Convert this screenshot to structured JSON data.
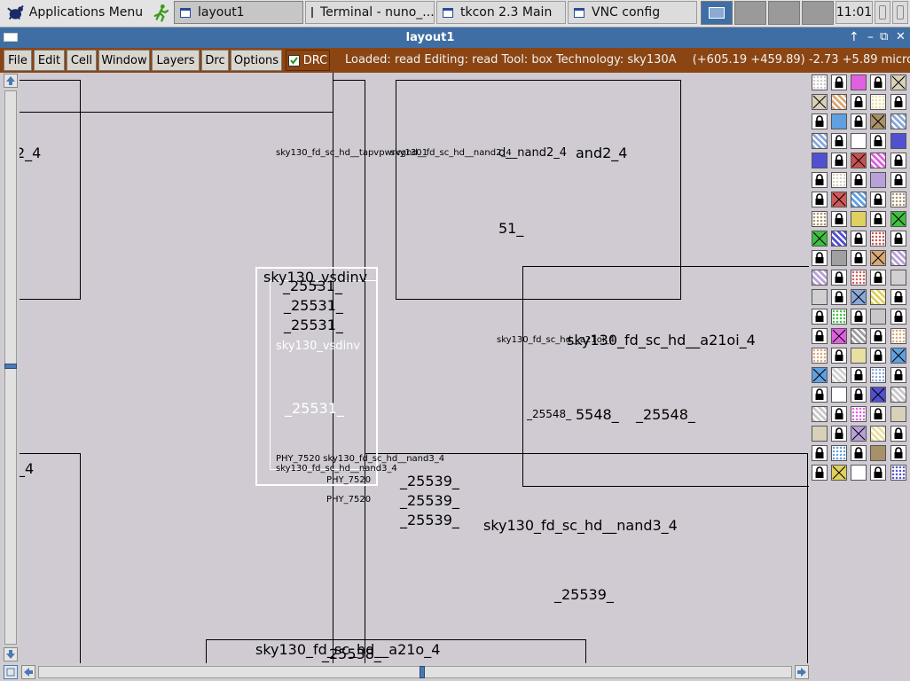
{
  "taskbar": {
    "apps_menu": "Applications Menu",
    "windows": [
      {
        "label": "layout1",
        "icon": "window-icon"
      },
      {
        "label": "Terminal - nuno_...",
        "icon": "terminal-icon"
      },
      {
        "label": "tkcon 2.3 Main",
        "icon": "window-icon"
      },
      {
        "label": "VNC config",
        "icon": "window-icon"
      }
    ],
    "clock": "11:01"
  },
  "window": {
    "title": "layout1",
    "controls": [
      "↑",
      "–",
      "⧉",
      "✕"
    ]
  },
  "menu": {
    "items": [
      "File",
      "Edit",
      "Cell",
      "Window",
      "Layers",
      "Drc",
      "Options"
    ],
    "drc_label": "DRC",
    "drc_checked": true
  },
  "status": {
    "text": "Loaded: read Editing: read Tool: box  Technology: sky130A",
    "coords": "(+605.19 +459.89) -2.73 +5.89 microns"
  },
  "canvas_labels": {
    "l_2_4": "2_4",
    "l_4": "_4",
    "tap_small": "sky130_fd_sc_hd__tapvpwrvgnd_1",
    "nand2_small": "sky130_fd_sc_hd__nand2_4",
    "nand2_mid": "d__nand2_4",
    "nand2_big": "and2_4",
    "l_51": "51_",
    "vsdinv_big": "sky130_vsdinv",
    "vsdinv_small": "sky130_vsdinv",
    "n25531": "_25531_",
    "a21oi_small": "sky130_fd_sc_hd__a21oi_4",
    "a21oi_big": "sky130_fd_sc_hd__a21oi_4",
    "n25548": "_25548_",
    "n5548": "5548_",
    "phy_7520": "PHY_7520",
    "phy_combo": "PHY_7520 sky130_fd_sc_hd__nand3_4",
    "nand3_small": "sky130_fd_sc_hd__nand3_4",
    "nand3_big": "sky130_fd_sc_hd__nand3_4",
    "n25539": "_25539_",
    "a21o_big": "sky130_fd_sc_hd__a21o_4",
    "n25538": "_25538_"
  }
}
